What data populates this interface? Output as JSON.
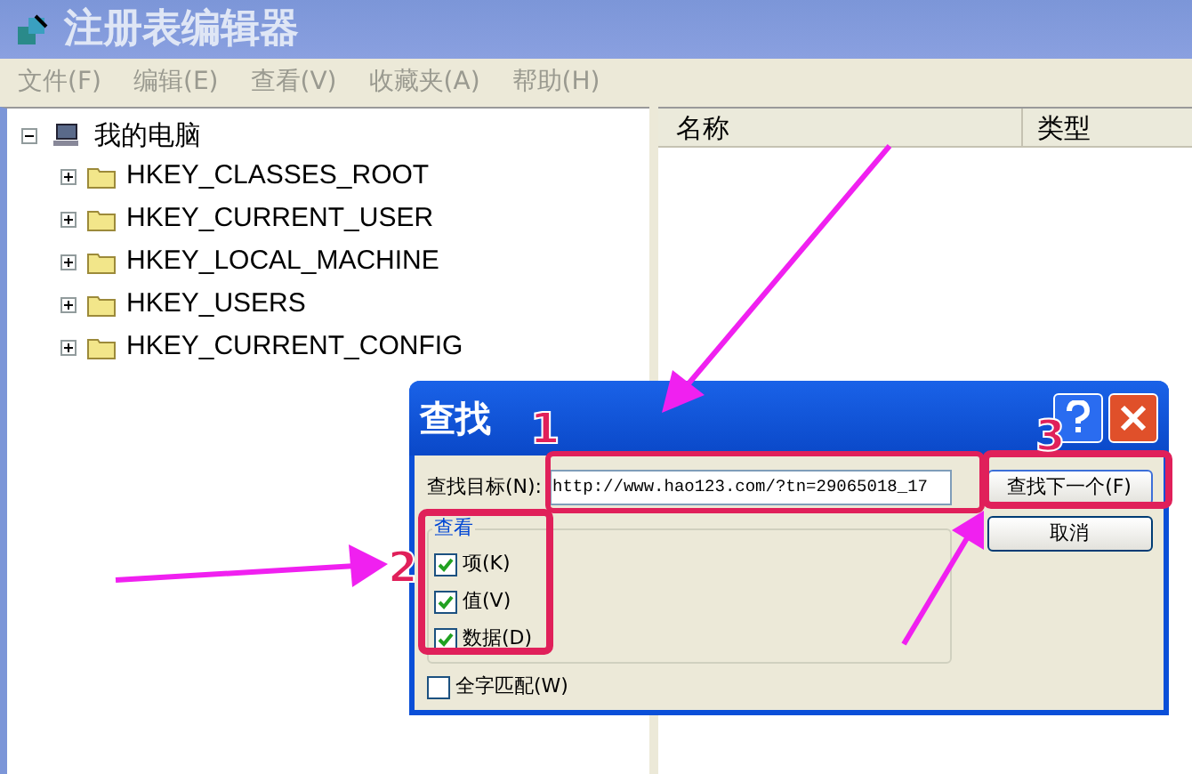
{
  "window": {
    "title": "注册表编辑器"
  },
  "menu": [
    "文件(F)",
    "编辑(E)",
    "查看(V)",
    "收藏夹(A)",
    "帮助(H)"
  ],
  "tree": {
    "label": "我的电脑",
    "expanded": true,
    "children": [
      {
        "label": "HKEY_CLASSES_ROOT",
        "expanded": false
      },
      {
        "label": "HKEY_CURRENT_USER",
        "expanded": false
      },
      {
        "label": "HKEY_LOCAL_MACHINE",
        "expanded": false
      },
      {
        "label": "HKEY_USERS",
        "expanded": false
      },
      {
        "label": "HKEY_CURRENT_CONFIG",
        "expanded": false
      }
    ]
  },
  "columns": [
    "名称",
    "类型"
  ],
  "dialog": {
    "title": "查找",
    "target_label": "查找目标(N):",
    "target_value": "http://www.hao123.com/?tn=29065018_17",
    "group_title": "查看",
    "options": [
      {
        "label": "项(K)",
        "checked": true
      },
      {
        "label": "值(V)",
        "checked": true
      },
      {
        "label": "数据(D)",
        "checked": true
      }
    ],
    "whole_word": {
      "label": "全字匹配(W)",
      "checked": false
    },
    "buttons": [
      "查找下一个(F)",
      "取消"
    ]
  },
  "annotations": [
    "1",
    "2",
    "3"
  ]
}
